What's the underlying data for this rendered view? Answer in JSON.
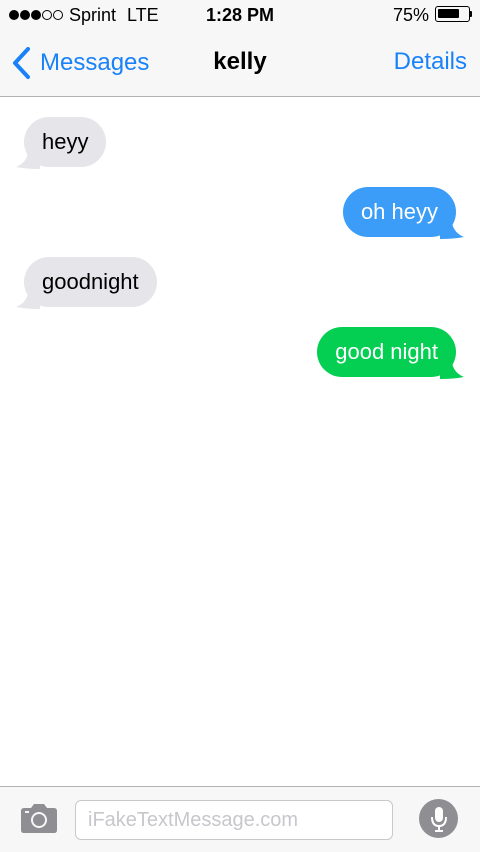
{
  "status_bar": {
    "signal_strength": "3 of 5",
    "carrier": "Sprint",
    "network": "LTE",
    "time": "1:28 PM",
    "battery_percent": "75%",
    "battery_level": 0.75
  },
  "nav": {
    "back_label": "Messages",
    "title": "kelly",
    "details_label": "Details"
  },
  "messages": [
    {
      "text": "heyy",
      "direction": "received",
      "color": "#e5e5ea"
    },
    {
      "text": "oh heyy",
      "direction": "sent",
      "color": "#3b9df7"
    },
    {
      "text": "goodnight",
      "direction": "received",
      "color": "#e5e5ea"
    },
    {
      "text": "good night",
      "direction": "sent",
      "color": "#04cf52"
    }
  ],
  "input_bar": {
    "placeholder": "iFakeTextMessage.com"
  },
  "colors": {
    "accent": "#1a82f8",
    "imessage_blue": "#3b9df7",
    "sms_green": "#04cf52",
    "received_gray": "#e5e5ea",
    "mic_gray": "#8e8e93"
  },
  "icons": {
    "back": "chevron-left-icon",
    "camera": "camera-icon",
    "mic": "microphone-icon"
  }
}
